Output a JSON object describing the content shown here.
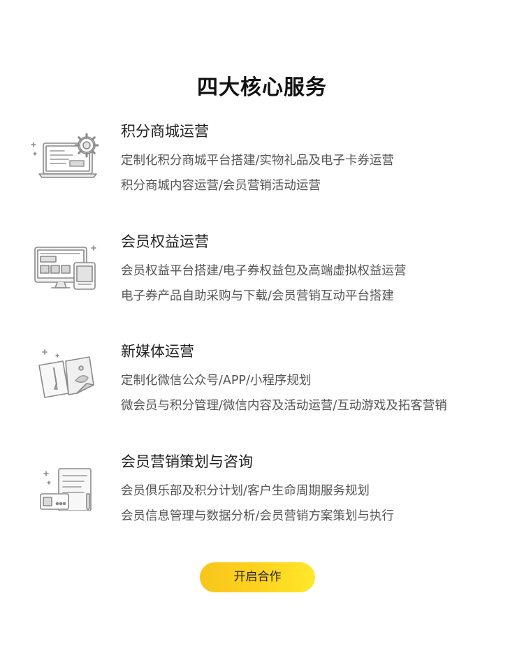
{
  "page": {
    "title": "四大核心服务"
  },
  "services": [
    {
      "icon": "laptop-gear-icon",
      "title": "积分商城运营",
      "line1": "定制化积分商城平台搭建/实物礼品及电子卡券运营",
      "line2": "积分商城内容运营/会员营销活动运营"
    },
    {
      "icon": "monitor-tablet-icon",
      "title": "会员权益运营",
      "line1": "会员权益平台搭建/电子券权益包及高端虚拟权益运营",
      "line2": "电子券产品自助采购与下载/会员营销互动平台搭建"
    },
    {
      "icon": "documents-pen-icon",
      "title": "新媒体运营",
      "line1": "定制化微信公众号/APP/小程序规划",
      "line2": "微会员与积分管理/微信内容及活动运营/互动游戏及拓客营销"
    },
    {
      "icon": "document-card-pen-icon",
      "title": "会员营销策划与咨询",
      "line1": "会员俱乐部及积分计划/客户生命周期服务规划",
      "line2": "会员信息管理与数据分析/会员营销方案策划与执行"
    }
  ],
  "cta": {
    "label": "开启合作"
  },
  "colors": {
    "button_gradient_start": "#f7c51c",
    "button_gradient_end": "#ffe82a",
    "icon_stroke": "#8a8a8a",
    "title_text": "#111111",
    "body_text": "#555555"
  }
}
